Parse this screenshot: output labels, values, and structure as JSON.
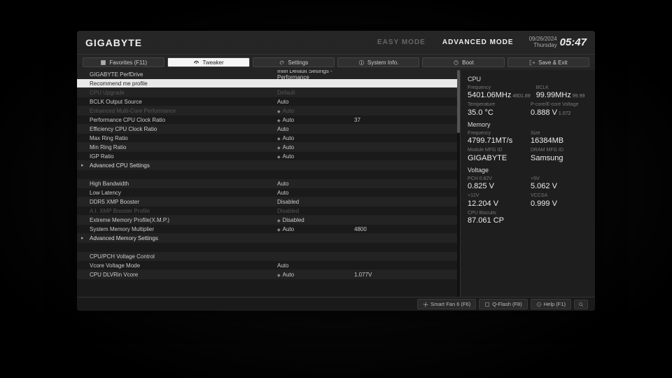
{
  "brand": "GIGABYTE",
  "modes": {
    "easy": "EASY MODE",
    "advanced": "ADVANCED MODE"
  },
  "date": "09/26/2024",
  "day": "Thursday",
  "time": "05:47",
  "tabs": {
    "favorites": "Favorites (F11)",
    "tweaker": "Tweaker",
    "settings": "Settings",
    "sysinfo": "System Info.",
    "boot": "Boot",
    "save": "Save & Exit"
  },
  "rows": [
    {
      "lbl": "GIGABYTE PerfDrive",
      "val": "Intel Default Settings - Performance",
      "odd": true
    },
    {
      "lbl": "Recommend me profile",
      "highlight": true
    },
    {
      "lbl": "CPU Upgrade",
      "val": "Default",
      "dim": true
    },
    {
      "lbl": "BCLK Output Source",
      "val": "Auto"
    },
    {
      "lbl": "Enhanced Multi-Core Performance",
      "val": "Auto",
      "bullet": true,
      "dim": true
    },
    {
      "lbl": "Performance CPU Clock Ratio",
      "val": "Auto",
      "extra": "37",
      "bullet": true
    },
    {
      "lbl": "Efficiency CPU Clock Ratio",
      "val": "Auto"
    },
    {
      "lbl": "Max Ring Ratio",
      "val": "Auto",
      "bullet": true
    },
    {
      "lbl": "Min Ring Ratio",
      "val": "Auto",
      "bullet": true
    },
    {
      "lbl": "IGP Ratio",
      "val": "Auto",
      "bullet": true
    },
    {
      "lbl": "Advanced CPU Settings",
      "section": true,
      "caret": true
    },
    {
      "lbl": "",
      "spacer": true
    },
    {
      "lbl": "High Bandwidth",
      "val": "Auto"
    },
    {
      "lbl": "Low Latency",
      "val": "Auto"
    },
    {
      "lbl": "DDR5 XMP Booster",
      "val": "Disabled"
    },
    {
      "lbl": "A.I. XMP Booster Profile",
      "val": "Disabled",
      "dim": true
    },
    {
      "lbl": "Extreme Memory Profile(X.M.P.)",
      "val": "Disabled",
      "bullet": true
    },
    {
      "lbl": "System Memory Multiplier",
      "val": "Auto",
      "extra": "4800",
      "bullet": true
    },
    {
      "lbl": "Advanced Memory Settings",
      "section": true,
      "caret": true
    },
    {
      "lbl": "",
      "spacer": true
    },
    {
      "lbl": "CPU/PCH Voltage Control"
    },
    {
      "lbl": "Vcore Voltage Mode",
      "val": "Auto"
    },
    {
      "lbl": "CPU DLVRin Vcore",
      "val": "Auto",
      "extra": "1.077V",
      "bullet": true
    }
  ],
  "side": {
    "cpu": {
      "title": "CPU",
      "freq_k": "Frequency",
      "freq_v": "5401.06MHz",
      "freq_s": "4601.89",
      "bclk_k": "BCLK",
      "bclk_v": "99.99MHz",
      "bclk_s": "99.99",
      "temp_k": "Temperature",
      "temp_v": "35.0 °C",
      "volt_k": "P-core/E-core Voltage",
      "volt_v": "0.888 V",
      "volt_s": "1.072"
    },
    "mem": {
      "title": "Memory",
      "freq_k": "Frequency",
      "freq_v": "4799.71MT/s",
      "size_k": "Size",
      "size_v": "16384MB",
      "mod_k": "Module MFG ID",
      "mod_v": "GIGABYTE",
      "dram_k": "DRAM MFG ID",
      "dram_v": "Samsung"
    },
    "volt": {
      "title": "Voltage",
      "pch_k": "PCH 0.82V",
      "pch_v": "0.825 V",
      "p5_k": "+5V",
      "p5_v": "5.062 V",
      "p12_k": "+12V",
      "p12_v": "12.204 V",
      "vccsa_k": "VCCSA",
      "vccsa_v": "0.999 V",
      "bis_k": "CPU Biscuits",
      "bis_v": "87.061 CP"
    }
  },
  "footer": {
    "smartfan": "Smart Fan 6 (F6)",
    "qflash": "Q-Flash (F8)",
    "help": "Help (F1)"
  }
}
